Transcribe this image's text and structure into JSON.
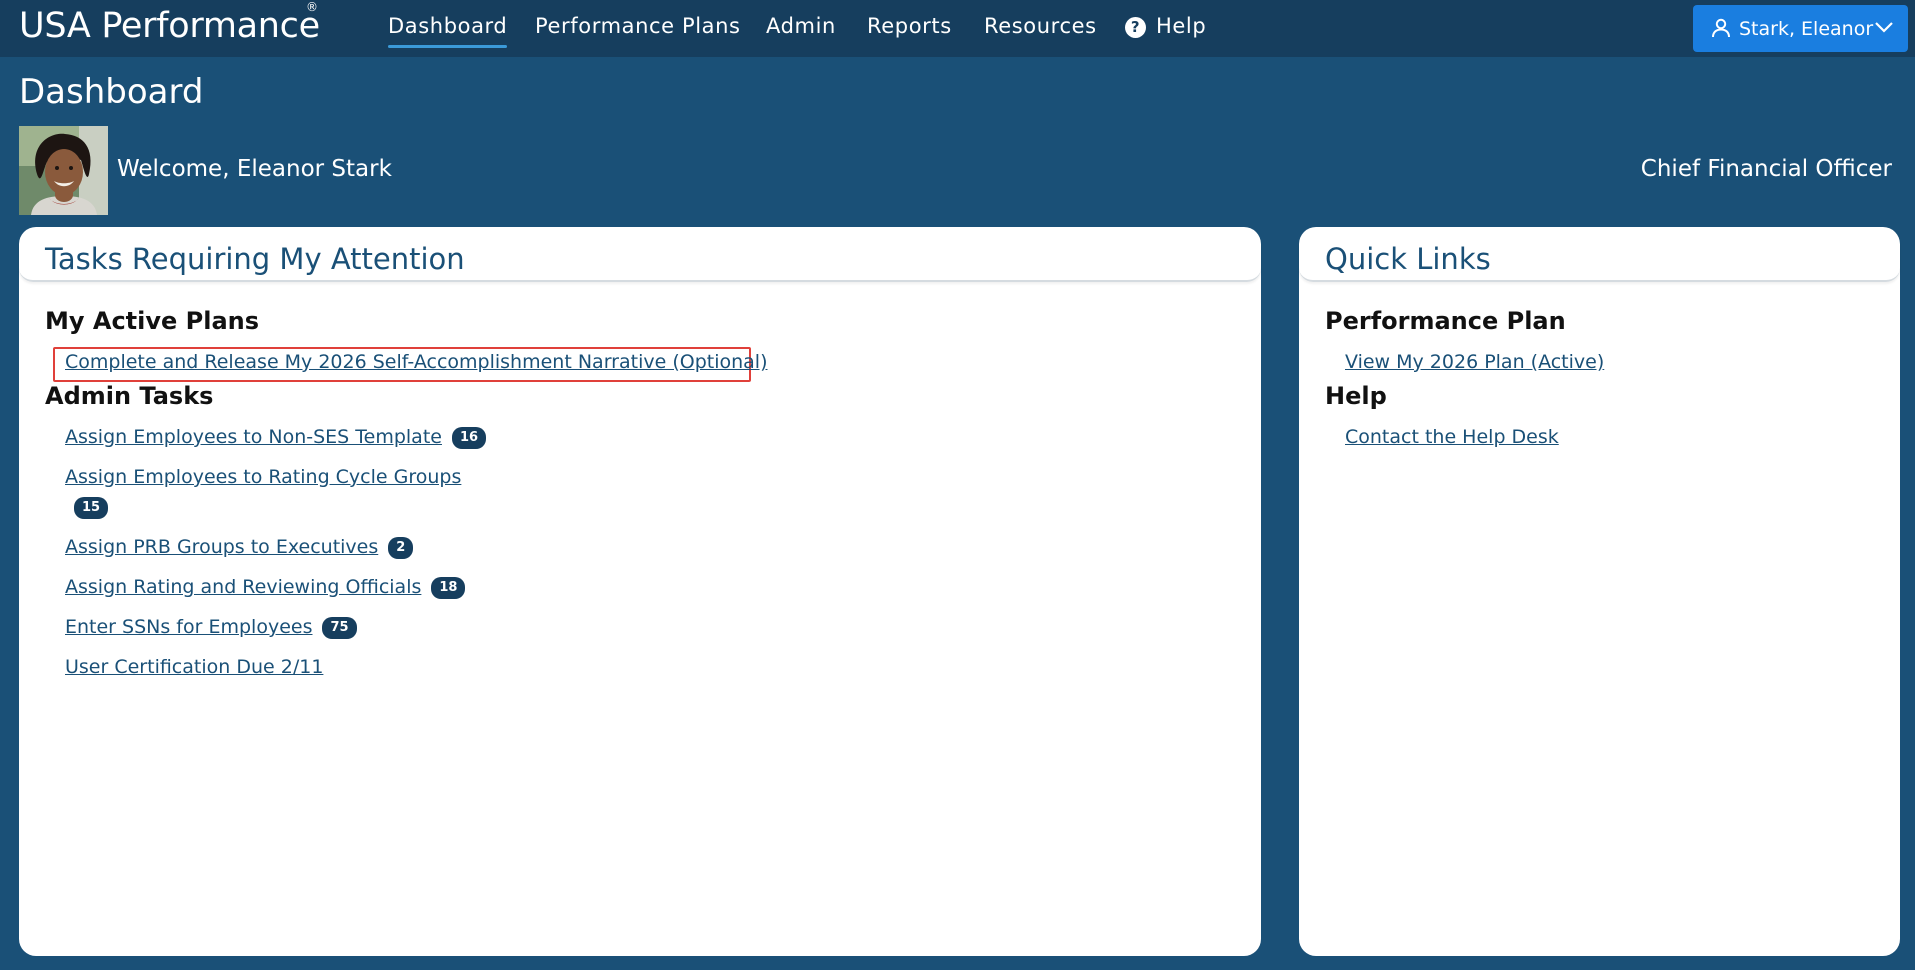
{
  "nav": {
    "brand": "USA Performance",
    "brand_mark": "®",
    "items": [
      {
        "label": "Dashboard",
        "active": true
      },
      {
        "label": "Performance Plans",
        "active": false
      },
      {
        "label": "Admin",
        "active": false
      },
      {
        "label": "Reports",
        "active": false
      },
      {
        "label": "Resources",
        "active": false
      },
      {
        "label": "Help",
        "active": false,
        "icon": "question-circle-icon"
      }
    ],
    "user_menu": {
      "label": "Stark, Eleanor",
      "icon": "user-icon"
    }
  },
  "header": {
    "title": "Dashboard",
    "welcome": "Welcome, Eleanor Stark",
    "job_title": "Chief Financial Officer"
  },
  "tasks": {
    "title": "Tasks Requiring My Attention",
    "sections": [
      {
        "heading": "My Active Plans",
        "items": [
          {
            "label": "Complete and Release My 2026 Self-Accomplishment Narrative (Optional)"
          }
        ]
      },
      {
        "heading": "Admin Tasks",
        "items": [
          {
            "label": "Assign Employees to Non-SES Template",
            "count": "16"
          },
          {
            "label": "Assign Employees to Rating Cycle Groups",
            "count": "15"
          },
          {
            "label": "Assign PRB Groups to Executives",
            "count": "2"
          },
          {
            "label": "Assign Rating and Reviewing Officials",
            "count": "18"
          },
          {
            "label": "Enter SSNs for Employees",
            "count": "75"
          },
          {
            "label": "User Certification Due 2/11"
          }
        ]
      }
    ]
  },
  "quick_links": {
    "title": "Quick Links",
    "sections": [
      {
        "heading": "Performance Plan",
        "items": [
          {
            "label": "View My 2026 Plan (Active)"
          }
        ]
      },
      {
        "heading": "Help",
        "items": [
          {
            "label": "Contact the Help Desk"
          }
        ]
      }
    ]
  },
  "colors": {
    "page_bg": "#1a5077",
    "nav_bg": "#163e5e",
    "accent": "#1a7ee0",
    "link": "#1a5077",
    "highlight": "#e0403a"
  }
}
